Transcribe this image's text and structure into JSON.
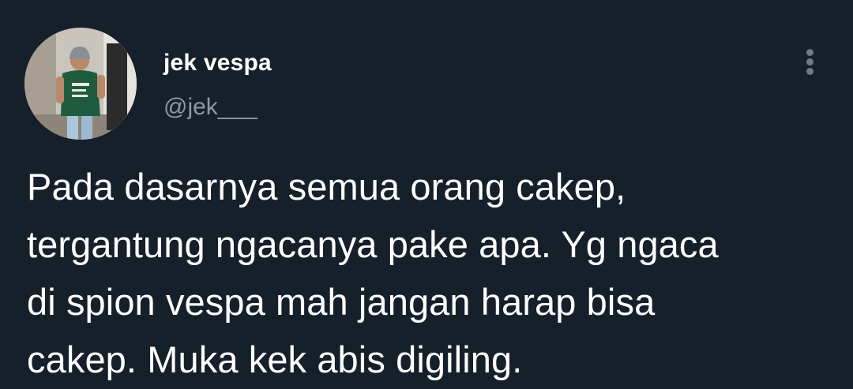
{
  "tweet": {
    "author": {
      "display_name": "jek vespa",
      "handle": "@jek___",
      "avatar_icon": "user-photo-avatar"
    },
    "more_options_icon": "vertical-ellipsis-icon",
    "text": "Pada dasarnya semua orang cakep,\ntergantung ngacanya pake apa. Yg ngaca\ndi spion vespa mah jangan harap bisa\ncakep. Muka kek abis digiling.",
    "colors": {
      "background": "#15202b",
      "text": "#ffffff",
      "secondary_text": "#8b98a5",
      "icon": "#6e7b86"
    }
  }
}
